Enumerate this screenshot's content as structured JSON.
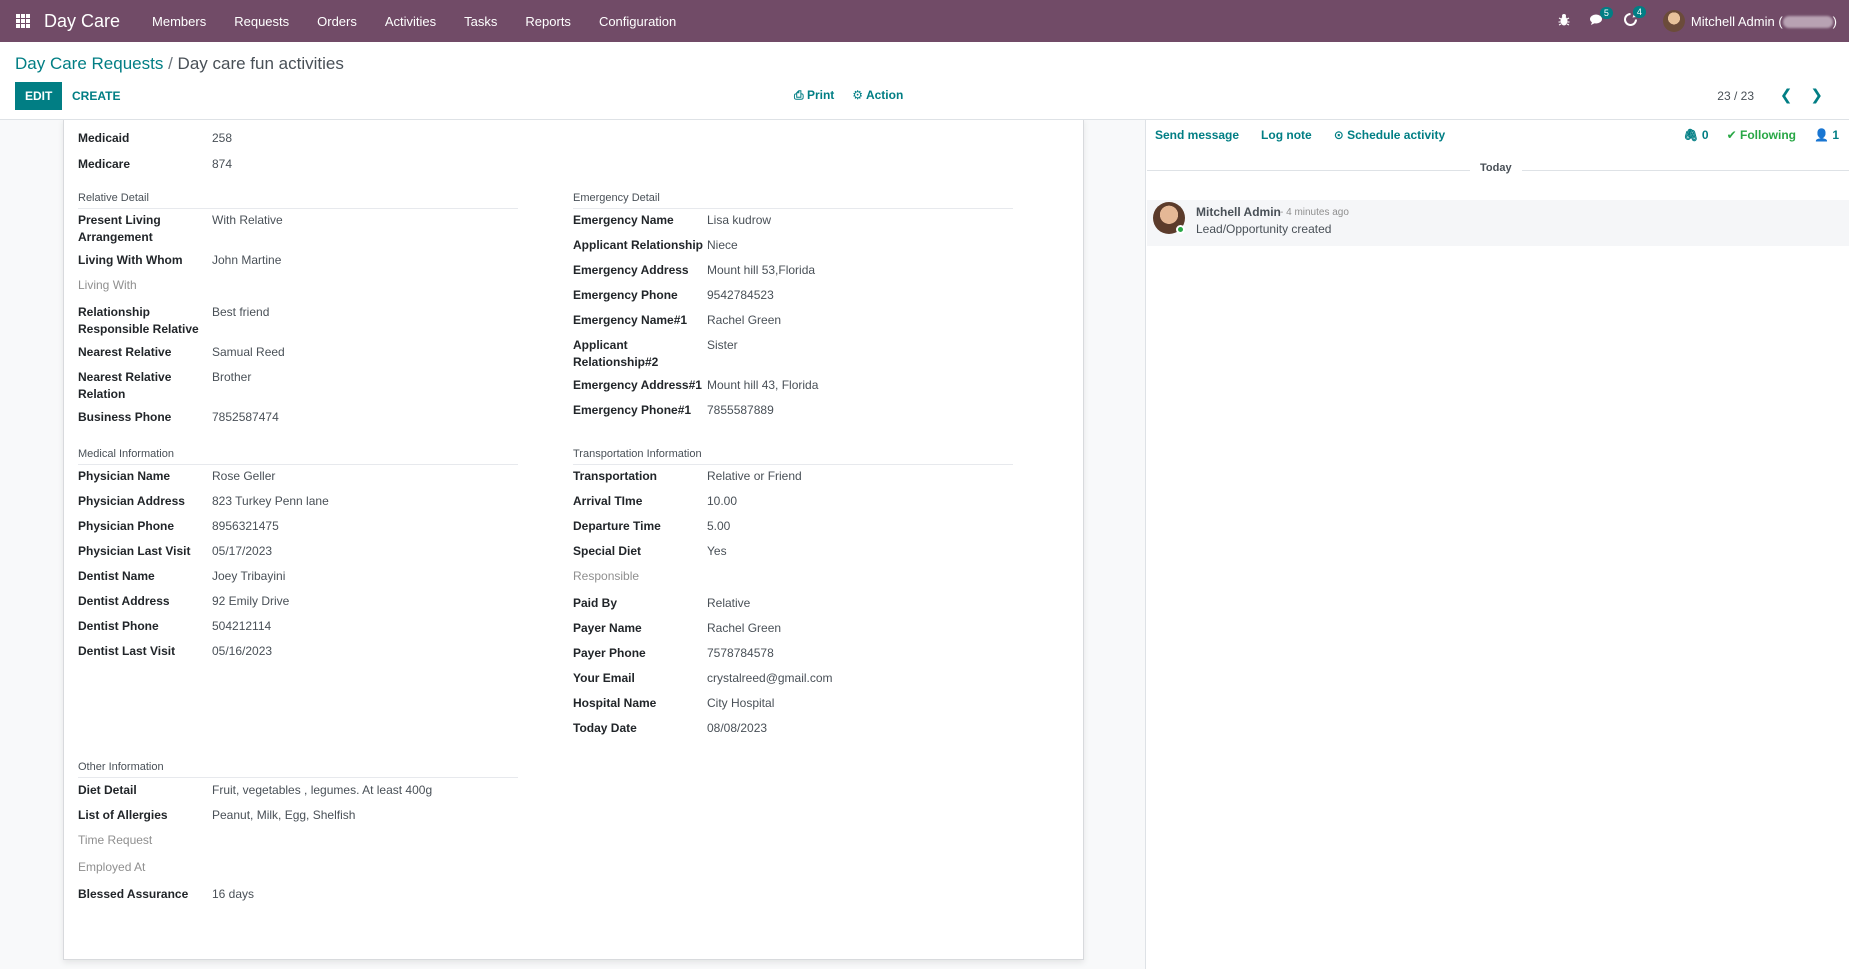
{
  "navbar": {
    "brand": "Day Care",
    "menu": [
      "Members",
      "Requests",
      "Orders",
      "Activities",
      "Tasks",
      "Reports",
      "Configuration"
    ],
    "messages_badge": "5",
    "activities_badge": "4",
    "user": "Mitchell Admin ("
  },
  "control_panel": {
    "breadcrumb_parent": "Day Care Requests",
    "breadcrumb_separator": "/",
    "breadcrumb_current": "Day care fun activities",
    "edit_label": "EDIT",
    "create_label": "CREATE",
    "print_label": "Print",
    "action_label": "Action",
    "pager": "23 / 23"
  },
  "form": {
    "top_fields": [
      {
        "label": "Medicaid",
        "value": "258"
      },
      {
        "label": "Medicare",
        "value": "874"
      }
    ],
    "relative_section": "Relative Detail",
    "relative_fields": [
      {
        "label": "Present Living Arrangement",
        "value": "With Relative"
      },
      {
        "label": "Living With Whom",
        "value": "John Martine"
      },
      {
        "label": "Living With",
        "value": ""
      },
      {
        "label": "Relationship Responsible Relative",
        "value": "Best friend"
      },
      {
        "label": "Nearest Relative",
        "value": "Samual Reed"
      },
      {
        "label": "Nearest Relative Relation",
        "value": "Brother"
      },
      {
        "label": "Business Phone",
        "value": "7852587474"
      }
    ],
    "emergency_section": "Emergency Detail",
    "emergency_fields": [
      {
        "label": "Emergency Name",
        "value": "Lisa kudrow"
      },
      {
        "label": "Applicant Relationship",
        "value": "Niece"
      },
      {
        "label": "Emergency Address",
        "value": "Mount hill 53,Florida"
      },
      {
        "label": "Emergency Phone",
        "value": "9542784523"
      },
      {
        "label": "Emergency Name#1",
        "value": "Rachel Green"
      },
      {
        "label": "Applicant Relationship#2",
        "value": "Sister"
      },
      {
        "label": "Emergency Address#1",
        "value": "Mount hill 43, Florida"
      },
      {
        "label": "Emergency Phone#1",
        "value": "7855587889"
      }
    ],
    "medical_section": "Medical Information",
    "medical_fields": [
      {
        "label": "Physician Name",
        "value": "Rose Geller"
      },
      {
        "label": "Physician Address",
        "value": "823 Turkey Penn lane"
      },
      {
        "label": "Physician Phone",
        "value": "8956321475"
      },
      {
        "label": "Physician Last Visit",
        "value": "05/17/2023"
      },
      {
        "label": "Dentist Name",
        "value": "Joey Tribayini"
      },
      {
        "label": "Dentist Address",
        "value": "92 Emily Drive"
      },
      {
        "label": "Dentist Phone",
        "value": "504212114"
      },
      {
        "label": "Dentist Last Visit",
        "value": "05/16/2023"
      }
    ],
    "transport_section": "Transportation Information",
    "transport_fields": [
      {
        "label": "Transportation",
        "value": "Relative or Friend"
      },
      {
        "label": "Arrival TIme",
        "value": "10.00"
      },
      {
        "label": "Departure Time",
        "value": "5.00"
      },
      {
        "label": "Special Diet",
        "value": "Yes"
      },
      {
        "label": "Responsible",
        "value": ""
      },
      {
        "label": "Paid By",
        "value": "Relative"
      },
      {
        "label": "Payer Name",
        "value": "Rachel Green"
      },
      {
        "label": "Payer Phone",
        "value": "7578784578"
      },
      {
        "label": "Your Email",
        "value": "crystalreed@gmail.com"
      },
      {
        "label": "Hospital Name",
        "value": "City Hospital"
      },
      {
        "label": "Today Date",
        "value": "08/08/2023"
      }
    ],
    "other_section": "Other Information",
    "other_fields": [
      {
        "label": "Diet Detail",
        "value": "Fruit, vegetables , legumes. At least 400g"
      },
      {
        "label": "List of Allergies",
        "value": "Peanut, Milk, Egg, Shelfish"
      },
      {
        "label": "Time Request",
        "value": ""
      },
      {
        "label": "Employed At",
        "value": ""
      },
      {
        "label": "Blessed Assurance",
        "value": "16 days"
      }
    ]
  },
  "chatter": {
    "send_message": "Send message",
    "log_note": "Log note",
    "schedule_activity": "Schedule activity",
    "attachments_count": "0",
    "following": "Following",
    "followers_count": "1",
    "date_separator": "Today",
    "message": {
      "author": "Mitchell Admin",
      "time": "- 4 minutes ago",
      "body": "Lead/Opportunity created"
    }
  },
  "colors": {
    "navbar": "#714b67",
    "primary": "#017e84",
    "following": "#28a745"
  }
}
